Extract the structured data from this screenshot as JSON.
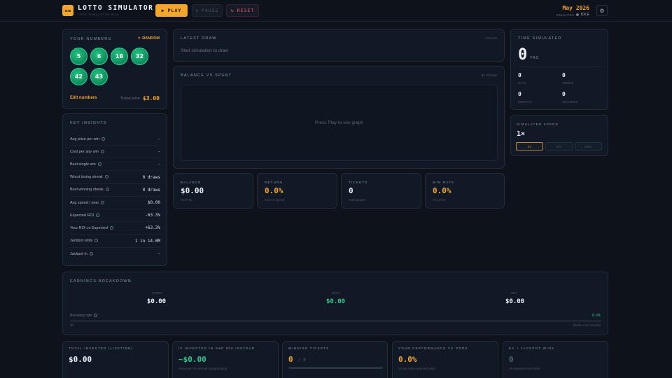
{
  "header": {
    "logo_text": "6/49",
    "title": "LOTTO SIMULATOR",
    "subtitle": "LOTO SIMULATOR 6/49",
    "play": "PLAY",
    "pause": "PAUSE",
    "reset": "RESET",
    "date": "May 2026",
    "status_label": "SIMULATED",
    "status": "IDLE",
    "colors": {
      "accent": "#f4a62a",
      "green": "#2dc98a",
      "red": "#ef5b5b"
    }
  },
  "numbers": {
    "title": "YOUR NUMBERS",
    "random": "RANDOM",
    "balls": [
      "5",
      "6",
      "18",
      "32",
      "42",
      "43"
    ],
    "edit": "Edit numbers",
    "ticket_label": "Ticket price",
    "ticket_price": "$3.00"
  },
  "insights": {
    "title": "KEY INSIGHTS",
    "rows": [
      {
        "label": "Avg prize per win",
        "value": "-"
      },
      {
        "label": "Cost per any win",
        "value": "-"
      },
      {
        "label": "Best single win",
        "value": "-"
      },
      {
        "label": "Worst losing streak",
        "value": "0 draws"
      },
      {
        "label": "Best winning streak",
        "value": "0 draws"
      },
      {
        "label": "Avg spend / year",
        "value": "$0.00"
      },
      {
        "label": "Expected ROI",
        "value": "-63.3%"
      },
      {
        "label": "Your ROI vs Expected",
        "value": "+63.3%"
      },
      {
        "label": "Jackpot odds",
        "value": "1 in 14.0M"
      },
      {
        "label": "Jackpot in",
        "value": "-"
      }
    ]
  },
  "draw": {
    "title": "LATEST DRAW",
    "tag": "Draw #0",
    "text": "Start simulation to draw"
  },
  "graph": {
    "title": "BALANCE VS SPENT",
    "tag": "$1.00/draw",
    "placeholder": "Press Play to see graph"
  },
  "stats": [
    {
      "label": "BALANCE",
      "value": "$0.00",
      "sub": "Net P&L"
    },
    {
      "label": "RETURN",
      "value": "0.0%",
      "sub": "ROI on spend"
    },
    {
      "label": "TICKETS",
      "value": "0",
      "sub": "Total played"
    },
    {
      "label": "WIN RATE",
      "value": "0.0%",
      "sub": "Any prize"
    }
  ],
  "time": {
    "title": "TIME SIMULATED",
    "years": "0",
    "years_unit": "YRS",
    "cells": [
      {
        "value": "0",
        "label": "DAYS"
      },
      {
        "value": "0",
        "label": "WEEKS"
      },
      {
        "value": "0",
        "label": "MONTHS"
      },
      {
        "value": "0",
        "label": "SECONDS"
      }
    ]
  },
  "speed": {
    "title": "SIMULATED SPEED",
    "value": "1×",
    "options": [
      "1×",
      "10×",
      "100×"
    ]
  },
  "earnings": {
    "title": "EARNINGS BREAKDOWN",
    "cols": [
      {
        "label": "SPENT",
        "value": "$0.00"
      },
      {
        "label": "WON",
        "value": "$0.00"
      },
      {
        "label": "NET",
        "value": "$0.00"
      }
    ],
    "recovery_label": "Recovery rate",
    "recovery_value": "0.0%",
    "recovery_fraction": 0,
    "left_note": "$0",
    "right_note": "Break-even needed"
  },
  "bottom": [
    {
      "label": "TOTAL INVESTED (LIFETIME)",
      "value": "$0.00",
      "sub": ""
    },
    {
      "label": "IF INVESTED IN S&P 500 INSTEAD",
      "value": "~$0.00",
      "sub": "Assumes 7% annual compounding"
    },
    {
      "label": "WINNING TICKETS",
      "value": "0",
      "value2": "/ 0",
      "sub": ""
    },
    {
      "label": "YOUR PERFORMANCE VS ODDS",
      "value": "0.0%",
      "sub": "Vs par with expected odds"
    },
    {
      "label": "EV + JACKPOT WINS",
      "value": "0",
      "sub": "All expected over time"
    }
  ]
}
